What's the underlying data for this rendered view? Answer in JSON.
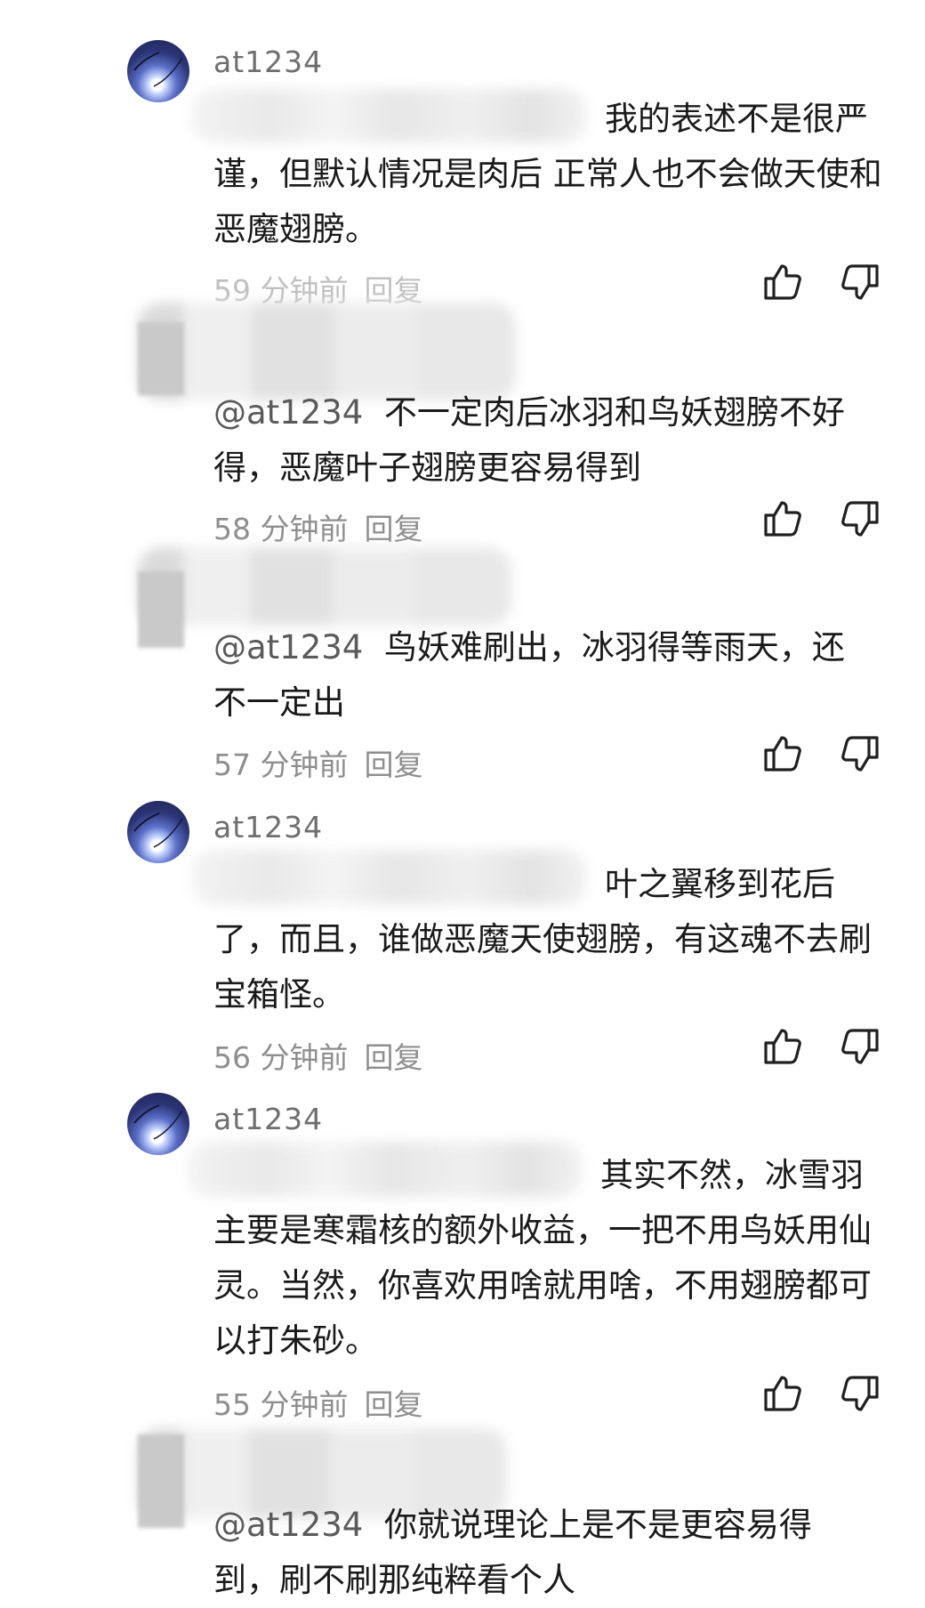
{
  "comments": [
    {
      "username": "at1234",
      "text": "我的表述不是很严谨，但默认情况是肉后 正常人也不会做天使和恶魔翅膀。",
      "time": "59 分钟前",
      "reply": "回复"
    },
    {
      "mention": "@at1234",
      "text": "不一定肉后冰羽和鸟妖翅膀不好得，恶魔叶子翅膀更容易得到",
      "time": "58 分钟前",
      "reply": "回复"
    },
    {
      "mention": "@at1234",
      "text": "鸟妖难刷出，冰羽得等雨天，还不一定出",
      "time": "57 分钟前",
      "reply": "回复"
    },
    {
      "username": "at1234",
      "text": "叶之翼移到花后了，而且，谁做恶魔天使翅膀，有这魂不去刷宝箱怪。",
      "time": "56 分钟前",
      "reply": "回复"
    },
    {
      "username": "at1234",
      "text": "其实不然，冰雪羽主要是寒霜核的额外收益，一把不用鸟妖用仙灵。当然，你喜欢用啥就用啥，不用翅膀都可以打朱砂。",
      "time": "55 分钟前",
      "reply": "回复"
    },
    {
      "mention": "@at1234",
      "text": "你就说理论上是不是更容易得到，刷不刷那纯粹看个人"
    }
  ],
  "icons": {
    "like": "thumbs-up-icon",
    "dislike": "thumbs-down-icon",
    "avatar": "avatar-icon"
  },
  "colors": {
    "text": "#1a1a1a",
    "meta": "#8e8e8e",
    "username": "#6e6e6e"
  }
}
